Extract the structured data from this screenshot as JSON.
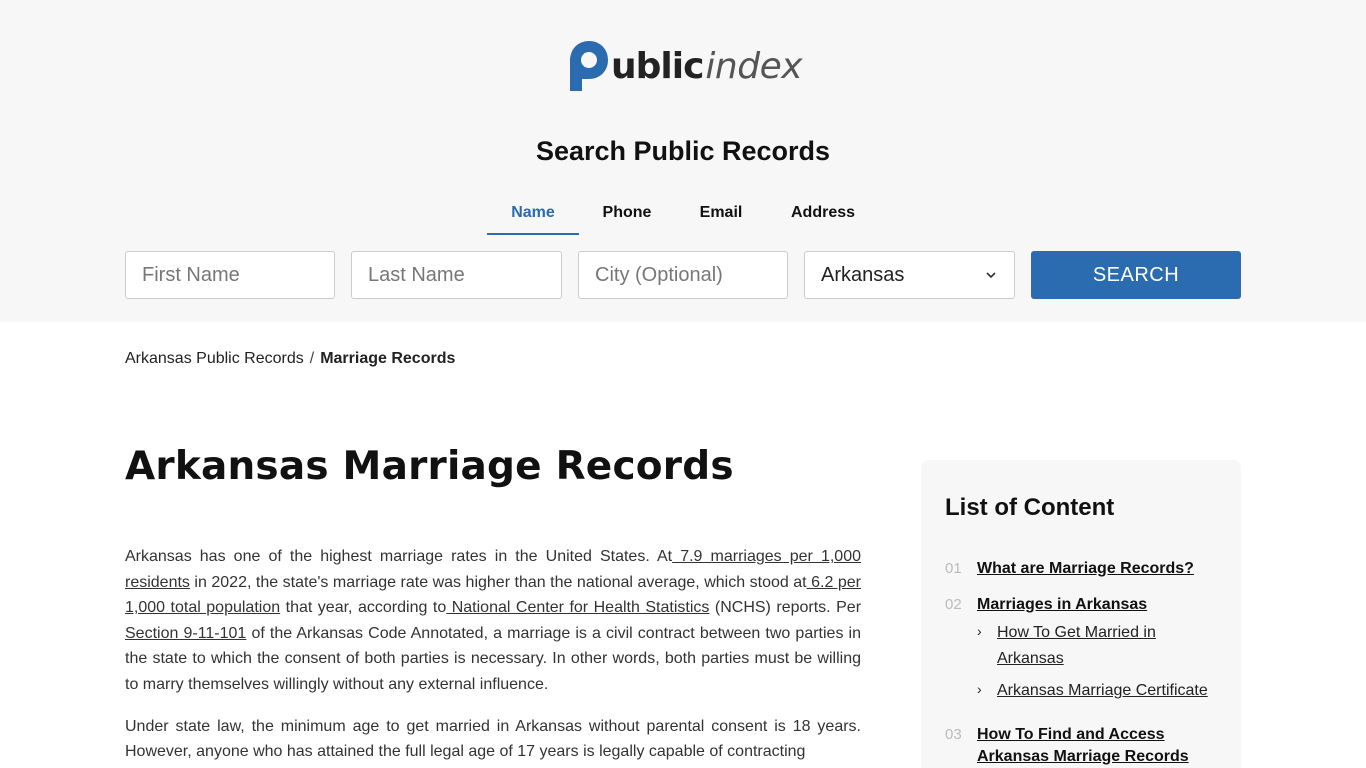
{
  "brand": {
    "logo_part1": "ublic",
    "logo_part2": "index",
    "accent_color": "#2b6cb0"
  },
  "search": {
    "title": "Search Public Records",
    "tabs": [
      {
        "label": "Name",
        "active": true
      },
      {
        "label": "Phone",
        "active": false
      },
      {
        "label": "Email",
        "active": false
      },
      {
        "label": "Address",
        "active": false
      }
    ],
    "first_name_placeholder": "First Name",
    "last_name_placeholder": "Last Name",
    "city_placeholder": "City (Optional)",
    "state_selected": "Arkansas",
    "button_label": "SEARCH"
  },
  "breadcrumb": {
    "parent": "Arkansas Public Records",
    "separator": "/",
    "current": "Marriage Records"
  },
  "page_title": "Arkansas Marriage Records",
  "article": {
    "p1": {
      "t1": "Arkansas has one of the highest marriage rates in the United States. At",
      "l1": " 7.9 marriages per 1,000 residents",
      "t2": " in 2022, the state's marriage rate was higher than the national average, which stood at",
      "l2": " 6.2 per 1,000 total population",
      "t3": " that year, according to",
      "l3": " National Center for Health Statistics",
      "t4": " (NCHS) reports. Per ",
      "l4": "Section 9-11-101",
      "t5": " of the Arkansas Code Annotated, a marriage is a civil contract between two parties in the state to which the consent of both parties is necessary. In other words, both parties must be willing to marry themselves willingly without any external influence."
    },
    "p2": "Under state law, the minimum age to get married in Arkansas without parental consent is 18 years. However, anyone who has attained the full legal age of 17 years is legally capable of contracting"
  },
  "toc": {
    "title": "List of Content",
    "items": [
      {
        "num": "01",
        "label": "What are Marriage Records?",
        "subs": []
      },
      {
        "num": "02",
        "label": "Marriages in Arkansas",
        "subs": [
          "How To Get Married in Arkansas",
          "Arkansas Marriage Certificate"
        ]
      },
      {
        "num": "03",
        "label": "How To Find and Access Arkansas Marriage Records",
        "subs": []
      }
    ]
  }
}
